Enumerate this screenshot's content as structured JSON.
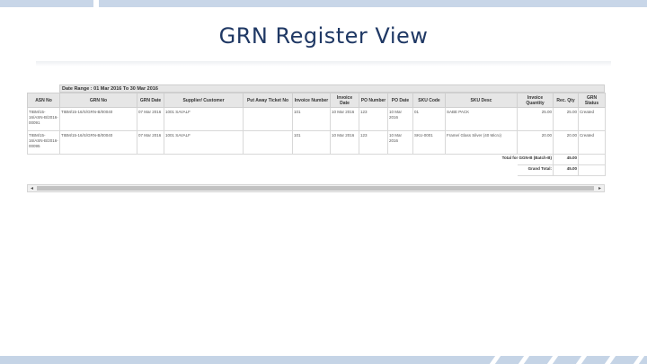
{
  "slide": {
    "title": "GRN Register View"
  },
  "report": {
    "date_range": "Date Range : 01 Mar 2016 To 30 Mar 2016",
    "columns": [
      "ASN No",
      "GRN No",
      "GRN Date",
      "Supplier/ Customer",
      "Put Away Ticket No",
      "Invoice Number",
      "Invoice Date",
      "PO Number",
      "PO Date",
      "SKU Code",
      "SKU Desc",
      "Invoice Quantity",
      "Rec. Qty",
      "GRN Status"
    ],
    "rows": [
      {
        "asn": "TIBM/15-16/ASN-B/2016-00091",
        "grn": "TIBM/15-16/S/GRN-B/00040",
        "grn_date": "07 Mar 2016",
        "supplier": "1001 SAVALF",
        "putaway": "",
        "invoice_no": "101",
        "invoice_date": "10 Mar 2016",
        "po_no": "123",
        "po_date": "10 Mar 2016",
        "sku_code": "01",
        "sku_desc": "SABE PACK",
        "invoice_qty": "25.00",
        "rec_qty": "25.00",
        "status": "Created"
      },
      {
        "asn": "TIBM/15-16/ASN-B/2016-00095",
        "grn": "TIBM/15-16/S/GRN-B/00040",
        "grn_date": "07 Mar 2016",
        "supplier": "1001 SAVALF",
        "putaway": "",
        "invoice_no": "101",
        "invoice_date": "10 Mar 2016",
        "po_no": "123",
        "po_date": "10 Mar 2016",
        "sku_code": "SKU-0001",
        "sku_desc": "Frame/ Glass Silver (40 Micro)",
        "invoice_qty": "20.00",
        "rec_qty": "20.00",
        "status": "Created"
      }
    ],
    "total_label": "Total for GGN-B (Batch-B)",
    "total_value": "45.00",
    "grand_total_label": "Grand Total:",
    "grand_total_value": "45.00"
  },
  "scrollbar": {
    "left_arrow": "◂",
    "right_arrow": "▸"
  }
}
